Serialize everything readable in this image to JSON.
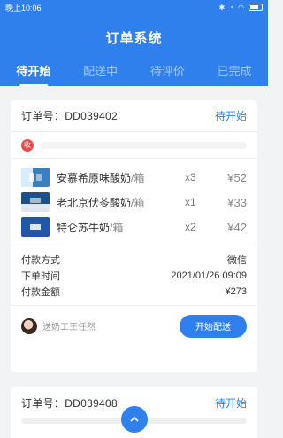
{
  "statusbar": {
    "time": "晚上10:06",
    "icons": [
      "bluetooth-icon",
      "alarm-icon",
      "wifi-icon",
      "battery-icon"
    ]
  },
  "header": {
    "title": "订单系统"
  },
  "tabs": [
    {
      "label": "待开始",
      "active": true
    },
    {
      "label": "配送中",
      "active": false
    },
    {
      "label": "待评价",
      "active": false
    },
    {
      "label": "已完成",
      "active": false
    }
  ],
  "orders": [
    {
      "order_no": "订单号：DD039402",
      "status": "待开始",
      "address_badge": "收",
      "items": [
        {
          "name": "安慕希原味酸奶",
          "unit": "/箱",
          "qty": "x3",
          "price": "¥52"
        },
        {
          "name": "老北京伏苓酸奶",
          "unit": "/箱",
          "qty": "x1",
          "price": "¥33"
        },
        {
          "name": "特仑苏牛奶",
          "unit": "/箱",
          "qty": "x2",
          "price": "¥42"
        }
      ],
      "info": [
        {
          "label": "付款方式",
          "value": "微信"
        },
        {
          "label": "下单时间",
          "value": "2021/01/26 09:09"
        },
        {
          "label": "付款金额",
          "value": "¥273"
        }
      ],
      "courier": "送奶工王任然",
      "action_label": "开始配送"
    },
    {
      "order_no": "订单号：DD039408",
      "status": "待开始"
    }
  ],
  "colors": {
    "accent": "#2f80ed",
    "badge": "#e84e4e"
  }
}
